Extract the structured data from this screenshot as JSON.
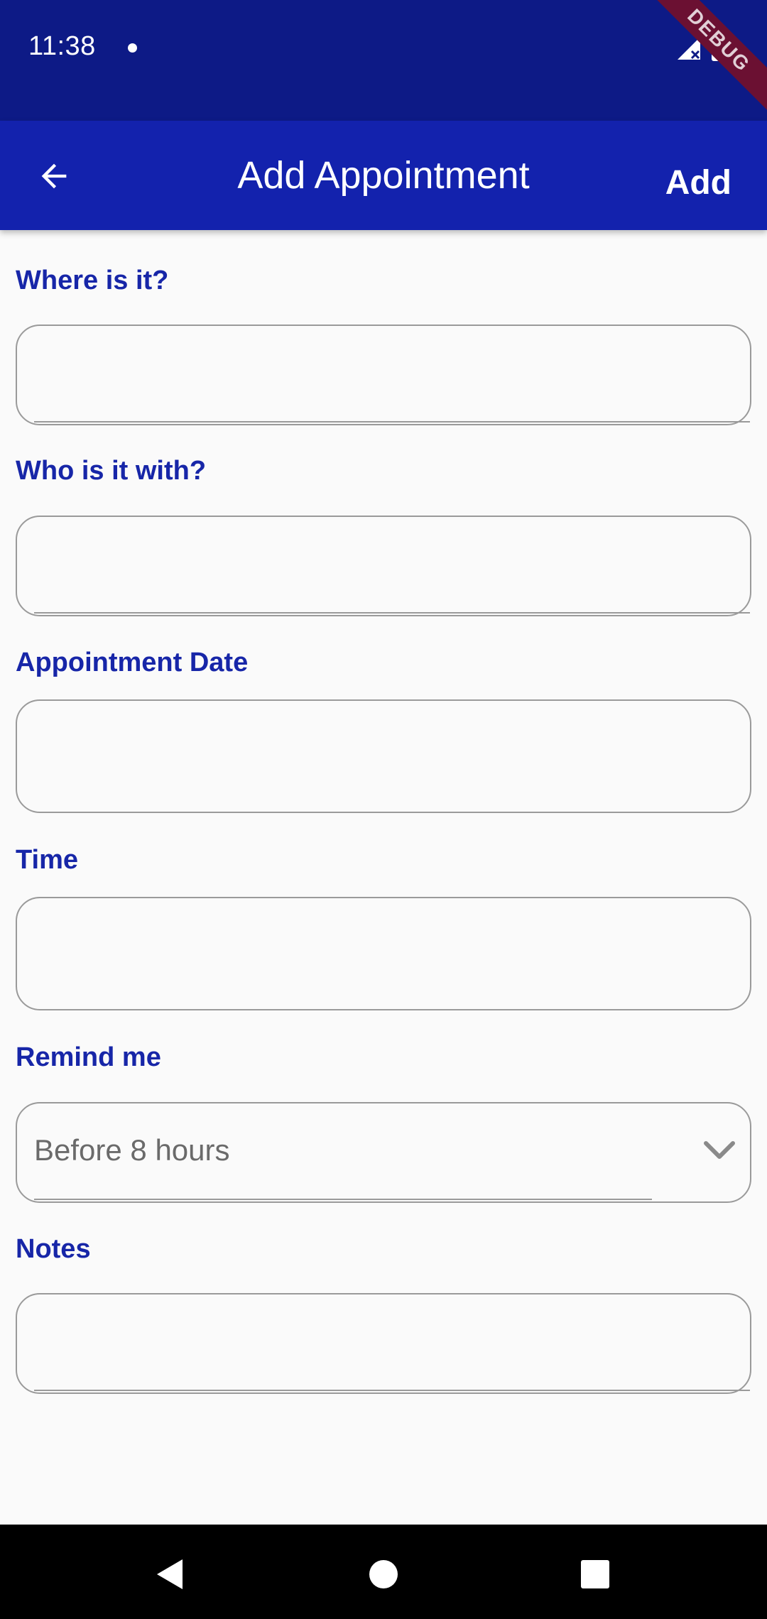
{
  "status_bar": {
    "time": "11:38",
    "debug_banner": "DEBUG"
  },
  "app_bar": {
    "title": "Add Appointment",
    "action_label": "Add"
  },
  "form": {
    "where": {
      "label": "Where is it?",
      "value": ""
    },
    "who": {
      "label": "Who is it with?",
      "value": ""
    },
    "date": {
      "label": "Appointment Date",
      "value": ""
    },
    "time": {
      "label": "Time",
      "value": ""
    },
    "remind": {
      "label": "Remind me",
      "selected": "Before  8 hours"
    },
    "notes": {
      "label": "Notes",
      "value": ""
    }
  },
  "colors": {
    "status_bar": "#0d1a86",
    "app_bar": "#1322ad",
    "label": "#1726a8",
    "border": "#9a9a9a",
    "background": "#fafafa"
  },
  "icons": {
    "back": "arrow-left-icon",
    "chevron": "chevron-down-icon",
    "signal": "signal-icon",
    "battery": "battery-icon",
    "nav_back": "triangle-back-icon",
    "nav_home": "circle-home-icon",
    "nav_recents": "square-recents-icon"
  }
}
